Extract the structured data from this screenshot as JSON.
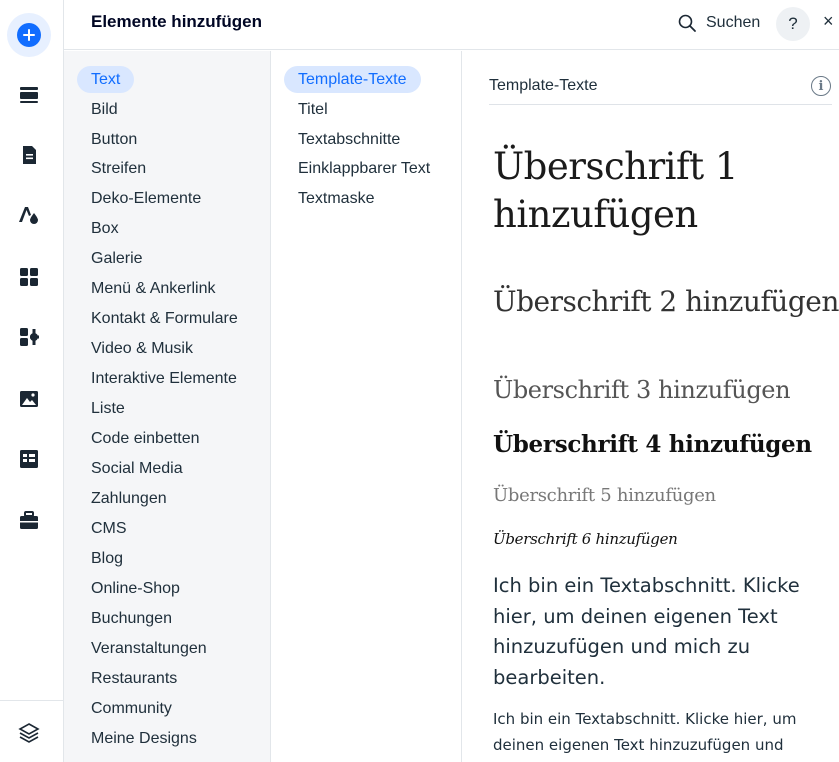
{
  "header": {
    "title": "Elemente hinzufügen",
    "search_label": "Suchen",
    "help_label": "?",
    "close_label": "×"
  },
  "rail": {
    "items": [
      {
        "name": "add-icon"
      },
      {
        "name": "strip-icon"
      },
      {
        "name": "page-icon"
      },
      {
        "name": "theme-icon"
      },
      {
        "name": "apps-icon"
      },
      {
        "name": "business-apps-icon"
      },
      {
        "name": "media-icon"
      },
      {
        "name": "cms-table-icon"
      },
      {
        "name": "portfolio-icon"
      },
      {
        "name": "layers-icon"
      }
    ]
  },
  "categories": [
    {
      "label": "Text",
      "active": true
    },
    {
      "label": "Bild"
    },
    {
      "label": "Button"
    },
    {
      "label": "Streifen"
    },
    {
      "label": "Deko-Elemente"
    },
    {
      "label": "Box"
    },
    {
      "label": "Galerie"
    },
    {
      "label": "Menü & Ankerlink"
    },
    {
      "label": "Kontakt & Formulare"
    },
    {
      "label": "Video & Musik"
    },
    {
      "label": "Interaktive Elemente"
    },
    {
      "label": "Liste"
    },
    {
      "label": "Code einbetten"
    },
    {
      "label": "Social Media"
    },
    {
      "label": "Zahlungen"
    },
    {
      "label": "CMS"
    },
    {
      "label": "Blog"
    },
    {
      "label": "Online-Shop"
    },
    {
      "label": "Buchungen"
    },
    {
      "label": "Veranstaltungen"
    },
    {
      "label": "Restaurants"
    },
    {
      "label": "Community"
    },
    {
      "label": "Meine Designs"
    }
  ],
  "subcategories": [
    {
      "label": "Template-Texte",
      "active": true
    },
    {
      "label": "Titel"
    },
    {
      "label": "Textabschnitte"
    },
    {
      "label": "Einklappbarer Text"
    },
    {
      "label": "Textmaske"
    }
  ],
  "preview": {
    "section_title": "Template-Texte",
    "info_label": "i",
    "h1": "Überschrift 1 hinzufügen",
    "h2": "Überschrift 2 hinzufügen",
    "h3": "Überschrift 3 hinzufügen",
    "h4": "Überschrift 4 hinzufügen",
    "h5": "Überschrift 5 hinzufügen",
    "h6": "Überschrift 6 hinzufügen",
    "p1": "Ich bin ein Textabschnitt. Klicke hier, um deinen eigenen Text hinzuzufügen und mich zu bearbeiten.",
    "p2": "Ich bin ein Textabschnitt. Klicke hier, um deinen eigenen Text hinzuzufügen und mich zu bearbeiten."
  },
  "colors": {
    "accent": "#116dff",
    "active_bg": "#d9e7ff",
    "panel_bg": "#f5f6f8"
  }
}
